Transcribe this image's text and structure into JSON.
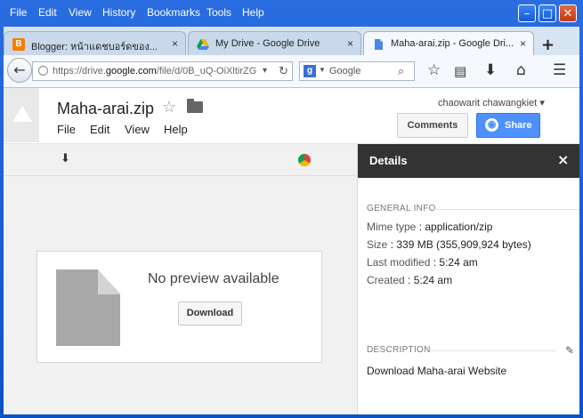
{
  "menubar": {
    "items": [
      "File",
      "Edit",
      "View",
      "History",
      "Bookmarks",
      "Tools",
      "Help"
    ]
  },
  "tabs": [
    {
      "title": "Blogger: หน้าแดชบอร์ดของ...",
      "close": "×",
      "icon": "blogger-icon"
    },
    {
      "title": "My Drive - Google Drive",
      "close": "×",
      "icon": "drive-icon"
    },
    {
      "title": "Maha-arai.zip - Google Dri...",
      "close": "×",
      "icon": "doc-icon"
    }
  ],
  "new_tab": "+",
  "nav": {
    "url_prefix": "https://drive.",
    "url_domain": "google.com",
    "url_rest": "/file/d/0B_uQ-OiXltirZG",
    "search_placeholder": "Google"
  },
  "doc": {
    "title": "Maha-arai.zip",
    "menu": [
      "File",
      "Edit",
      "View",
      "Help"
    ],
    "user": "chaowarit chawangkiet ▾",
    "comments_label": "Comments",
    "share_label": "Share"
  },
  "viewer": {
    "no_preview": "No preview available",
    "download_label": "Download"
  },
  "details": {
    "title": "Details",
    "close": "×",
    "general_info": "GENERAL INFO",
    "mime_key": "Mime type",
    "mime_val": "application/zip",
    "size_key": "Size",
    "size_val": "339 MB (355,909,924 bytes)",
    "modified_key": "Last modified",
    "modified_val": "5:24 am",
    "created_key": "Created",
    "created_val": "5:24 am",
    "description_label": "DESCRIPTION",
    "description_text": "Download Maha-arai Website"
  }
}
